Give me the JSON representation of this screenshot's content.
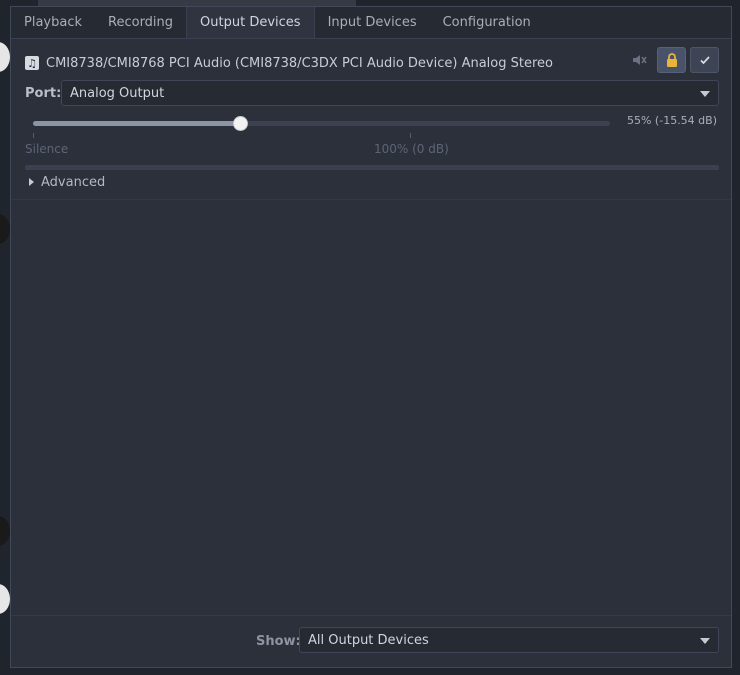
{
  "tabs": [
    {
      "label": "Playback",
      "active": false
    },
    {
      "label": "Recording",
      "active": false
    },
    {
      "label": "Output Devices",
      "active": true
    },
    {
      "label": "Input Devices",
      "active": false
    },
    {
      "label": "Configuration",
      "active": false
    }
  ],
  "device": {
    "name": "CMI8738/CMI8768 PCI Audio (CMI8738/C3DX PCI Audio Device) Analog Stereo",
    "icon": "audio-card-icon",
    "mute_icon": "speaker-muted-icon",
    "lock_icon": "lock-icon",
    "default_icon": "check-icon"
  },
  "port": {
    "label": "Port:",
    "value": "Analog Output"
  },
  "volume": {
    "percent": 55,
    "readout": "55% (-15.54 dB)",
    "silence_label": "Silence",
    "normal_label": "100% (0 dB)"
  },
  "advanced": {
    "label": "Advanced"
  },
  "footer": {
    "show_label": "Show:",
    "show_value": "All Output Devices"
  },
  "colors": {
    "window_bg": "#2b303b",
    "tabbar_bg": "#262a33",
    "accent_button": "#48536a"
  }
}
